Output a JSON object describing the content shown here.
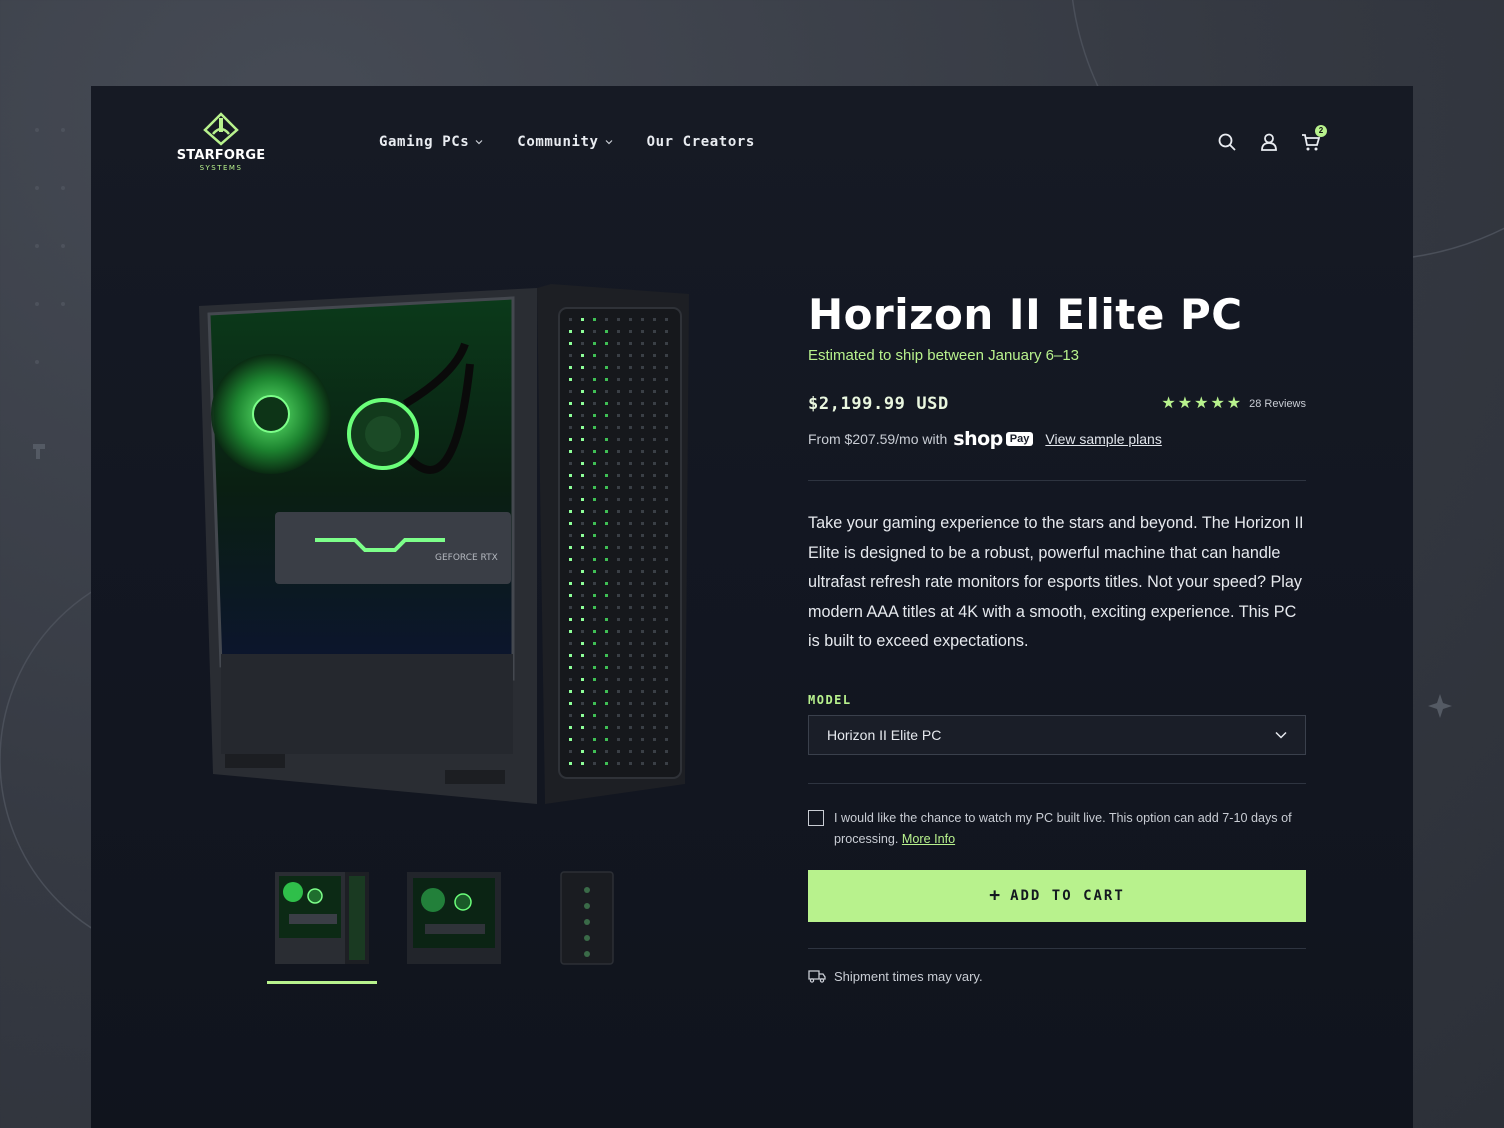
{
  "brand": {
    "name": "STARFORGE",
    "sub": "SYSTEMS"
  },
  "nav": {
    "items": [
      {
        "label": "Gaming PCs",
        "has_dropdown": true
      },
      {
        "label": "Community",
        "has_dropdown": true
      },
      {
        "label": "Our Creators",
        "has_dropdown": false
      }
    ]
  },
  "header_icons": {
    "search": "search-icon",
    "account": "user-icon",
    "cart": "cart-icon",
    "cart_count": "2"
  },
  "product": {
    "title": "Horizon II Elite PC",
    "ship_estimate": "Estimated to ship between January 6–13",
    "price": "$2,199.99 USD",
    "rating_stars": 5,
    "reviews": "28 Reviews",
    "installment_text": "From $207.59/mo with",
    "shop_word": "shop",
    "pay_word": "Pay",
    "sample_plans": "View sample plans",
    "description": "Take your gaming experience to the stars and beyond. The Horizon II Elite is designed to be a robust, powerful machine that can handle ultrafast refresh rate monitors for esports titles. Not your speed? Play modern AAA titles at 4K with a smooth, exciting experience. This PC is built to exceed expectations.",
    "model_label": "MODEL",
    "model_selected": "Horizon II Elite PC",
    "build_live_text": "I would like the chance to watch my PC built live. This option can add 7-10 days of processing.",
    "more_info": "More Info",
    "add_to_cart": "ADD TO CART",
    "shipment_note": "Shipment times may vary.",
    "gpu_label": "GEFORCE RTX"
  },
  "gallery": {
    "thumbnail_count": 3,
    "active_index": 0
  },
  "colors": {
    "accent": "#b8f28d",
    "panel": "#131722",
    "background": "#3a3e47"
  }
}
